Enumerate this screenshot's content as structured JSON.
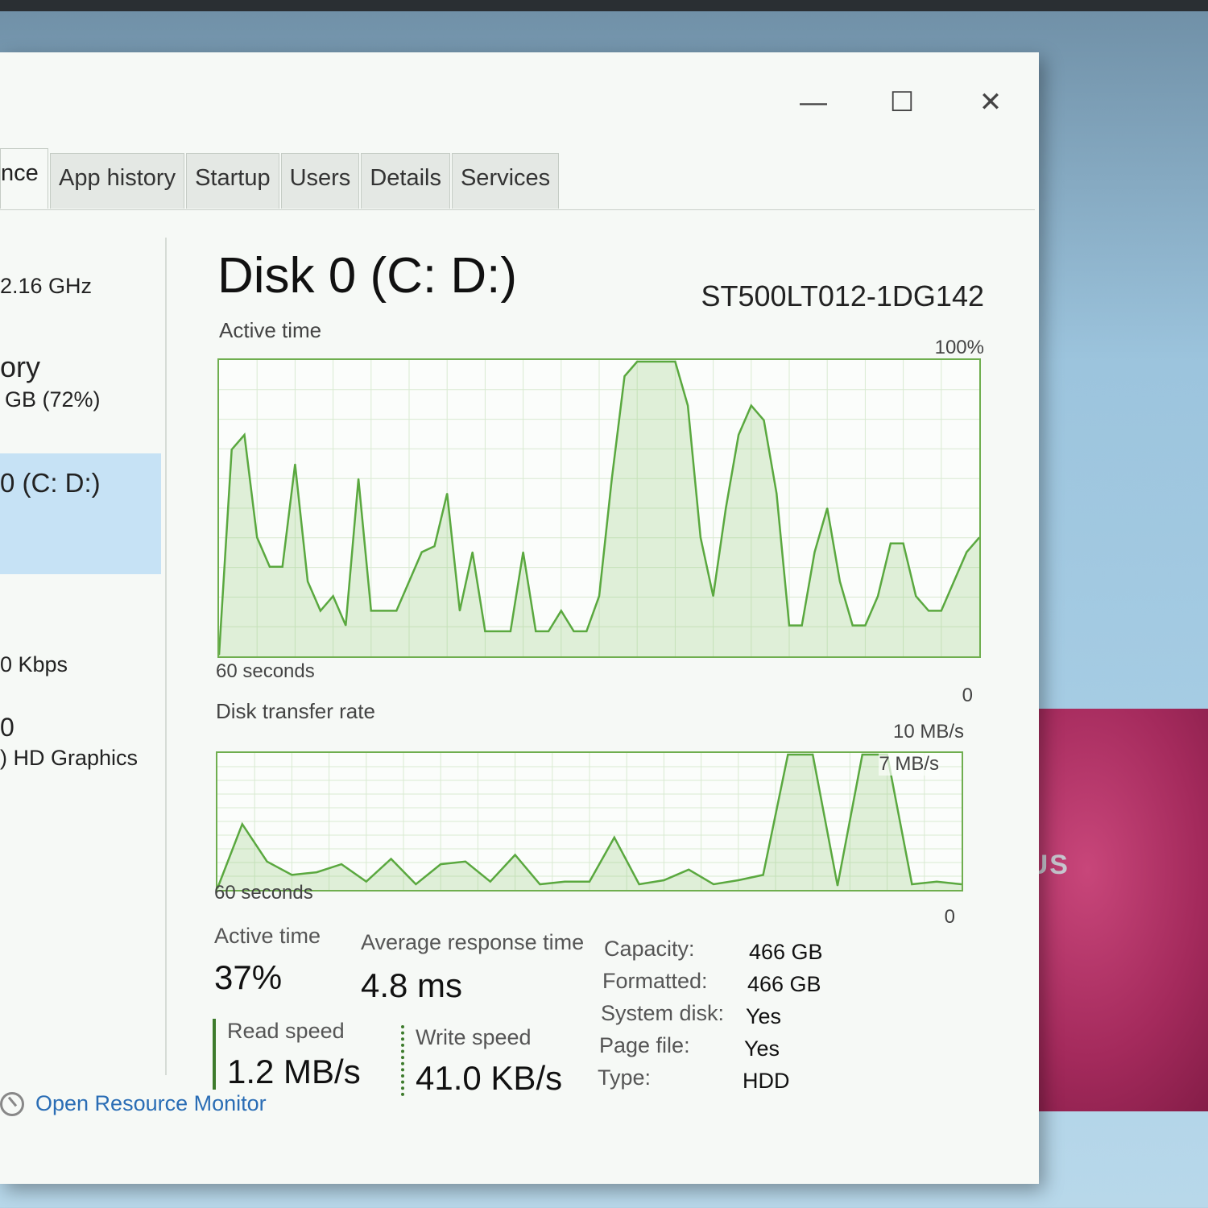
{
  "window_controls": {
    "minimize": "—",
    "maximize": "☐",
    "close": "✕"
  },
  "tabs": [
    "nce",
    "App history",
    "Startup",
    "Users",
    "Details",
    "Services"
  ],
  "sidebar": {
    "cpu_speed": "2.16 GHz",
    "memory_label": "ory",
    "memory_value": "GB (72%)",
    "disk_label": "0 (C: D:)",
    "network_value": "0 Kbps",
    "gpu_label": "0",
    "gpu_name": ") HD Graphics"
  },
  "main": {
    "title": "Disk 0 (C: D:)",
    "model": "ST500LT012-1DG142",
    "active_time_chart": {
      "label": "Active time",
      "max_label": "100%",
      "left_label": "60 seconds",
      "right_label": "0"
    },
    "transfer_chart": {
      "label": "Disk transfer rate",
      "max_label": "10 MB/s",
      "mid_label": "7 MB/s",
      "left_label": "60 seconds",
      "right_label": "0"
    },
    "stats": {
      "active_time_label": "Active time",
      "active_time_value": "37%",
      "avg_response_label": "Average response time",
      "avg_response_value": "4.8 ms",
      "read_speed_label": "Read speed",
      "read_speed_value": "1.2 MB/s",
      "write_speed_label": "Write speed",
      "write_speed_value": "41.0 KB/s"
    },
    "properties": [
      {
        "key": "Capacity:",
        "value": "466 GB"
      },
      {
        "key": "Formatted:",
        "value": "466 GB"
      },
      {
        "key": "System disk:",
        "value": "Yes"
      },
      {
        "key": "Page file:",
        "value": "Yes"
      },
      {
        "key": "Type:",
        "value": "HDD"
      }
    ]
  },
  "footer": {
    "open_resource_monitor": "Open Resource Monitor"
  },
  "device_logo": "SUS",
  "chart_data": [
    {
      "type": "area",
      "title": "Active time",
      "ylim": [
        0,
        100
      ],
      "xlabel": "60 seconds",
      "x": [
        60,
        59,
        58,
        57,
        56,
        55,
        54,
        53,
        52,
        51,
        50,
        49,
        48,
        47,
        46,
        45,
        44,
        43,
        42,
        41,
        40,
        39,
        38,
        37,
        36,
        35,
        34,
        33,
        32,
        31,
        30,
        29,
        28,
        27,
        26,
        25,
        24,
        23,
        22,
        21,
        20,
        19,
        18,
        17,
        16,
        15,
        14,
        13,
        12,
        11,
        10,
        9,
        8,
        7,
        6,
        5,
        4,
        3,
        2,
        1,
        0
      ],
      "values": [
        0,
        70,
        75,
        40,
        30,
        30,
        65,
        25,
        15,
        20,
        10,
        60,
        15,
        15,
        15,
        25,
        35,
        37,
        55,
        15,
        35,
        8,
        8,
        8,
        35,
        8,
        8,
        15,
        8,
        8,
        20,
        60,
        95,
        100,
        100,
        100,
        100,
        85,
        40,
        20,
        50,
        75,
        85,
        80,
        55,
        10,
        10,
        35,
        50,
        25,
        10,
        10,
        20,
        38,
        38,
        20,
        15,
        15,
        25,
        35,
        40
      ],
      "series_name": "",
      "color": "#5aa83f"
    },
    {
      "type": "area",
      "title": "Disk transfer rate",
      "ylim": [
        0,
        10
      ],
      "xlabel": "60 seconds",
      "x": [
        60,
        58,
        56,
        54,
        52,
        50,
        48,
        46,
        44,
        42,
        40,
        38,
        36,
        34,
        32,
        30,
        28,
        26,
        24,
        22,
        20,
        18,
        16,
        14,
        12,
        10,
        8,
        6,
        4,
        2,
        0
      ],
      "values": [
        0,
        4.8,
        2,
        1,
        1.2,
        1.8,
        0.5,
        2.2,
        0.3,
        1.8,
        2,
        0.5,
        2.5,
        0.3,
        0.5,
        0.5,
        3.8,
        0.3,
        0.6,
        1.4,
        0.3,
        0.6,
        1,
        10,
        10,
        0.2,
        10,
        10,
        0.3,
        0.5,
        0.3
      ],
      "series_name": "",
      "color": "#5aa83f"
    }
  ]
}
